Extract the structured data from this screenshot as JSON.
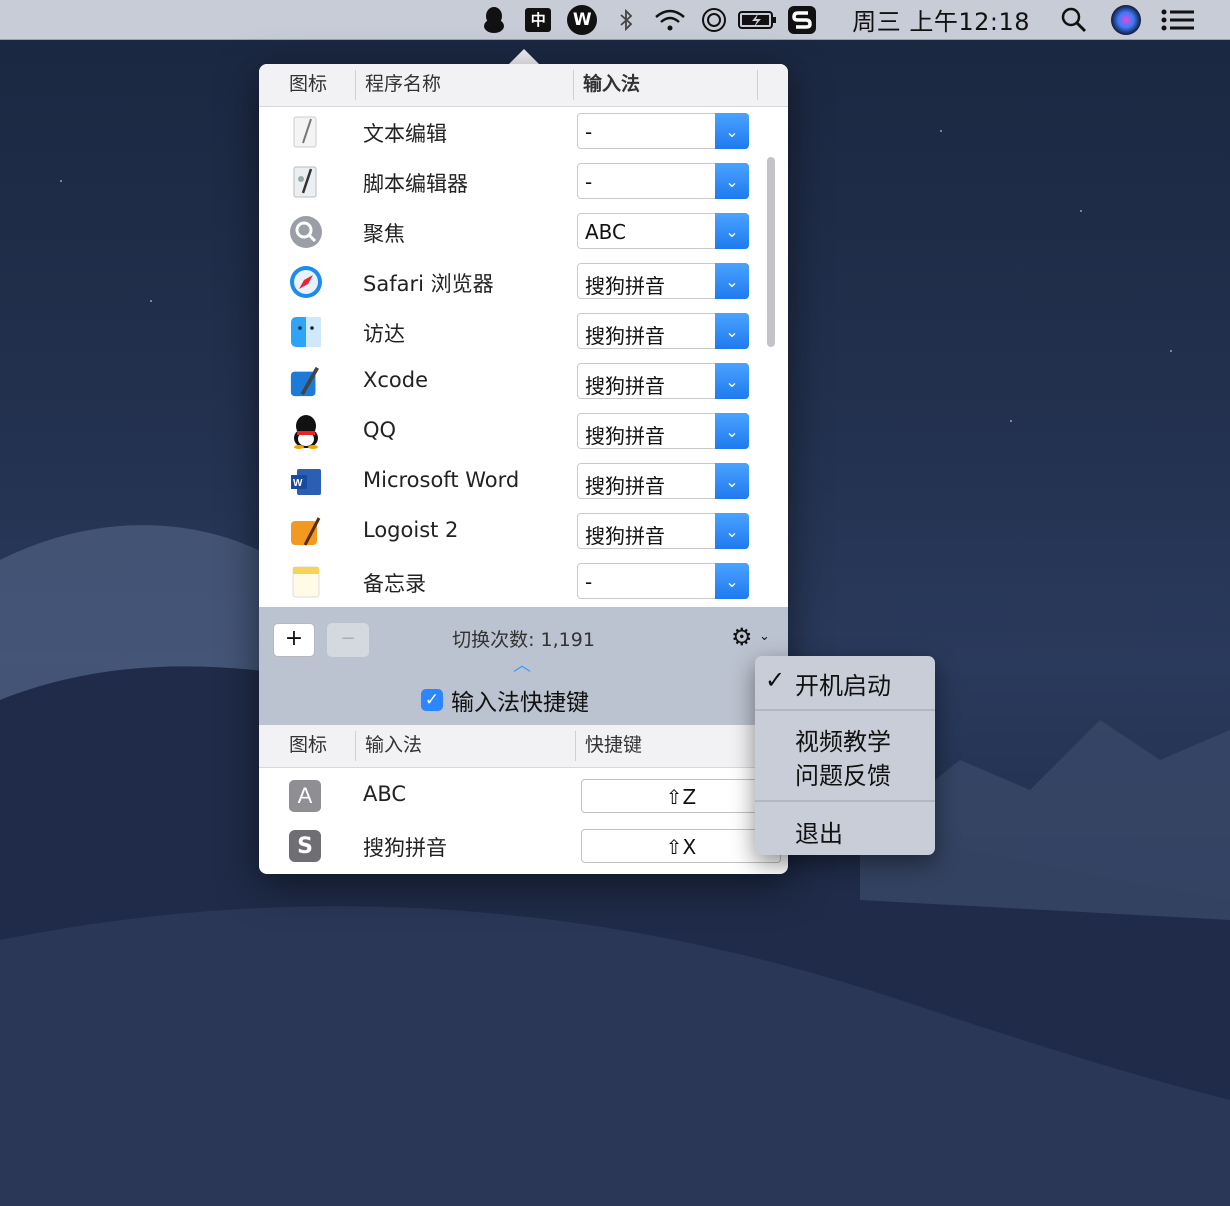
{
  "menubar": {
    "active_app_glyph": "W",
    "input_badge": "中",
    "clock": "周三 上午12:18",
    "icons": [
      "qq-penguin-icon",
      "chinese-input-icon",
      "app-w-icon",
      "bluetooth-icon",
      "wifi-icon",
      "time-machine-icon",
      "battery-icon",
      "sogou-icon",
      "spotlight-search-icon",
      "siri-icon",
      "notification-list-icon"
    ]
  },
  "app_table": {
    "headers": {
      "icon": "图标",
      "name": "程序名称",
      "input": "输入法"
    },
    "rows": [
      {
        "icon": "textedit-icon",
        "name": "文本编辑",
        "input": "-"
      },
      {
        "icon": "script-editor-icon",
        "name": "脚本编辑器",
        "input": "-"
      },
      {
        "icon": "spotlight-icon",
        "name": "聚焦",
        "input": "ABC"
      },
      {
        "icon": "safari-icon",
        "name": "Safari 浏览器",
        "input": "搜狗拼音"
      },
      {
        "icon": "finder-icon",
        "name": "访达",
        "input": "搜狗拼音"
      },
      {
        "icon": "xcode-icon",
        "name": "Xcode",
        "input": "搜狗拼音"
      },
      {
        "icon": "qq-icon",
        "name": "QQ",
        "input": "搜狗拼音"
      },
      {
        "icon": "word-icon",
        "name": "Microsoft Word",
        "input": "搜狗拼音"
      },
      {
        "icon": "logoist-icon",
        "name": "Logoist 2",
        "input": "搜狗拼音"
      },
      {
        "icon": "notes-icon",
        "name": "备忘录",
        "input": "-"
      }
    ]
  },
  "footer": {
    "add_label": "+",
    "remove_label": "−",
    "switch_count": "切换次数: 1,191",
    "shortcut_toggle_label": "输入法快捷键",
    "shortcut_checked": true
  },
  "shortcut_table": {
    "headers": {
      "icon": "图标",
      "input": "输入法",
      "shortcut": "快捷键"
    },
    "rows": [
      {
        "icon_letter": "A",
        "name": "ABC",
        "shortcut": "⇧Z"
      },
      {
        "icon_letter": "S",
        "name": "搜狗拼音",
        "shortcut": "⇧X"
      }
    ]
  },
  "gear_menu": {
    "launch_at_login": "开机启动",
    "launch_checked": true,
    "video_tutorial": "视频教学",
    "feedback": "问题反馈",
    "quit": "退出"
  },
  "colors": {
    "accent": "#1f7aef",
    "menubar": "#c8ccd6",
    "footer": "#bcc3d0"
  }
}
